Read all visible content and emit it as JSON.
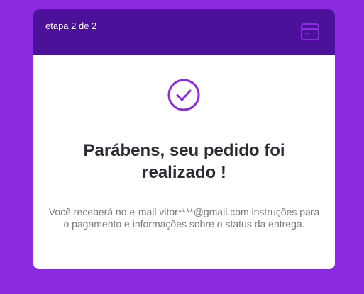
{
  "header": {
    "step_label": "etapa 2 de 2",
    "box_icon": "package-box-icon"
  },
  "confirmation": {
    "status_icon": "check-circle-icon",
    "title": "Parábens, seu pedido foi realizado !",
    "message": "Você receberá no e-mail vitor****@gmail.com instruções para o pagamento e informações sobre o status da entrega."
  },
  "colors": {
    "page_background": "#8a2be2",
    "header_background": "#4b1199",
    "accent": "#8a2be2",
    "title_text": "#2b2b33",
    "body_text": "#7a7a7a"
  }
}
